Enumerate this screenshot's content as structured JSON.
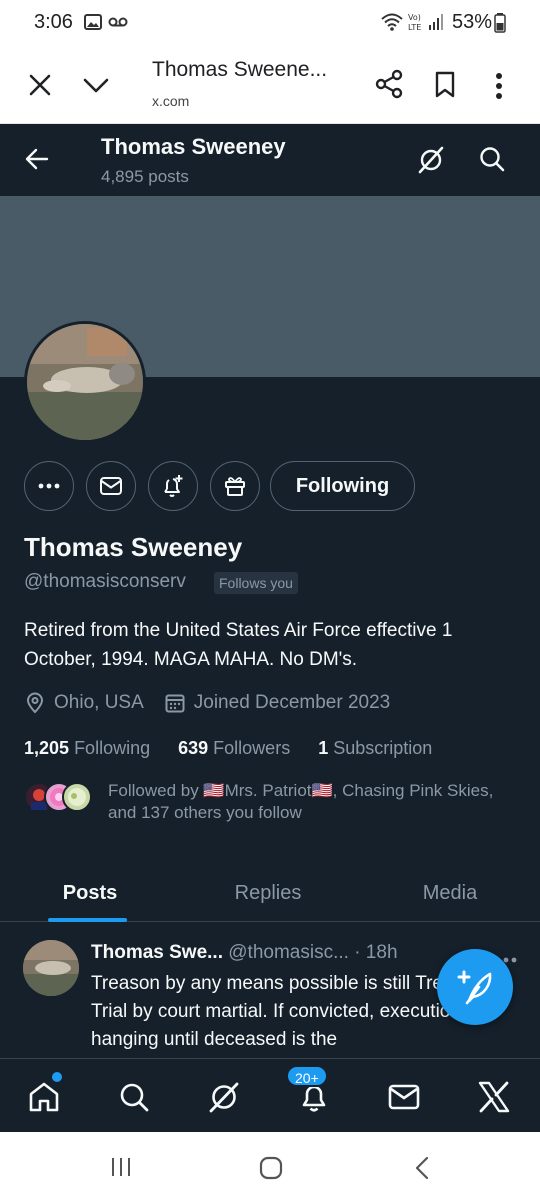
{
  "status_bar": {
    "time": "3:06",
    "battery": "53%"
  },
  "browser": {
    "title": "Thomas Sweene...",
    "url": "x.com"
  },
  "topbar": {
    "name": "Thomas Sweeney",
    "posts_count": "4,895 posts"
  },
  "profile": {
    "name": "Thomas Sweeney",
    "handle": "@thomasisconserv",
    "follows_you": "Follows you",
    "bio": "Retired from the United States Air Force effective 1 October, 1994.  MAGA MAHA.  No DM's.",
    "location": "Ohio, USA",
    "joined": "Joined December 2023",
    "following_btn": "Following",
    "stats": {
      "following_count": "1,205",
      "following_label": "Following",
      "followers_count": "639",
      "followers_label": "Followers",
      "subscription_count": "1",
      "subscription_label": "Subscription"
    },
    "followed_by": "Followed by 🇺🇸Mrs. Patriot🇺🇸, Chasing Pink Skies, and 137 others you follow"
  },
  "tabs": [
    {
      "label": "Posts"
    },
    {
      "label": "Replies"
    },
    {
      "label": "Media"
    }
  ],
  "post": {
    "author": "Thomas Swe...",
    "handle": "@thomasisc...",
    "time": "· 18h",
    "text": "Treason by any means possible is still Treason.  Trial by court martial.  If convicted, execution by hanging until deceased is the"
  },
  "bottom_nav": {
    "badge": "20+"
  },
  "colors": {
    "background": "#15202b",
    "accent": "#1d9bf0",
    "banner": "#4a5b68",
    "secondary_text": "#8b98a5"
  }
}
